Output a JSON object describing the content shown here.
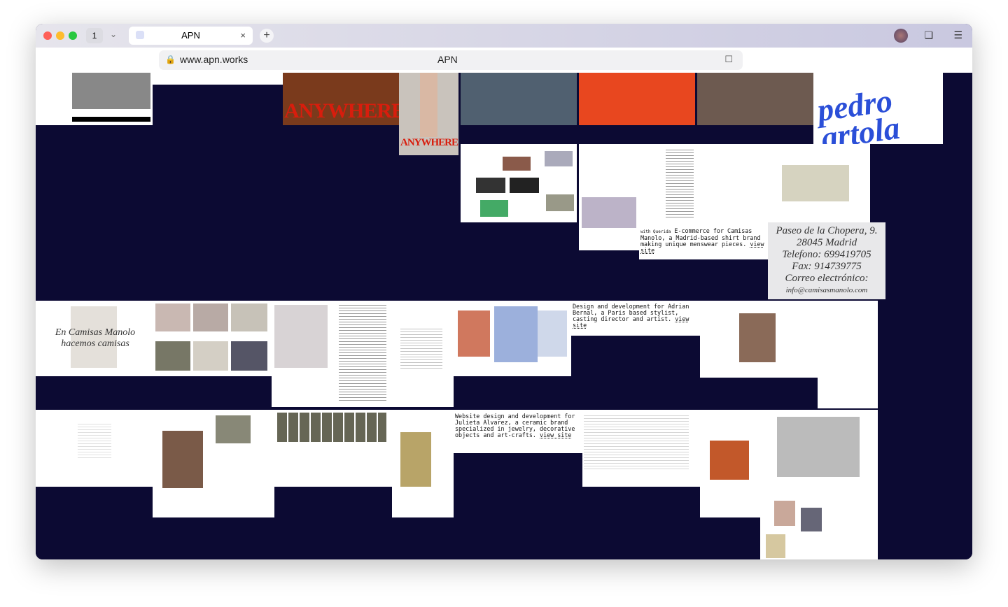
{
  "browser": {
    "tab_count": "1",
    "tab_title": "APN",
    "url": "www.apn.works",
    "page_title": "APN"
  },
  "tiles": {
    "anywhere": "ANYWHERE",
    "anywhere_small": "ANYWHERE",
    "pedro": "pedro artola",
    "camisas_script": "En Camisas Manolo hacemos camisas",
    "contact_lines": [
      "Paseo de la Chopera, 9.",
      "28045 Madrid",
      "Telefono: 699419705",
      "Fax: 914739775",
      "Correo electrónico:",
      "info@camisasmanolo.com"
    ]
  },
  "projects": [
    {
      "prefix": "with Querida",
      "text": "E-commerce for Camisas Manolo, a Madrid-based shirt brand making unique menswear pieces.",
      "link": "view site"
    },
    {
      "text": "Design and development for Adrian Bernal, a Paris based stylist, casting director and artist.",
      "link": "view site"
    },
    {
      "text": "Website design and development for Julieta Alvarez, a ceramic brand specialized in jewelry, decorative objects and art-crafts.",
      "link": "view site"
    }
  ]
}
